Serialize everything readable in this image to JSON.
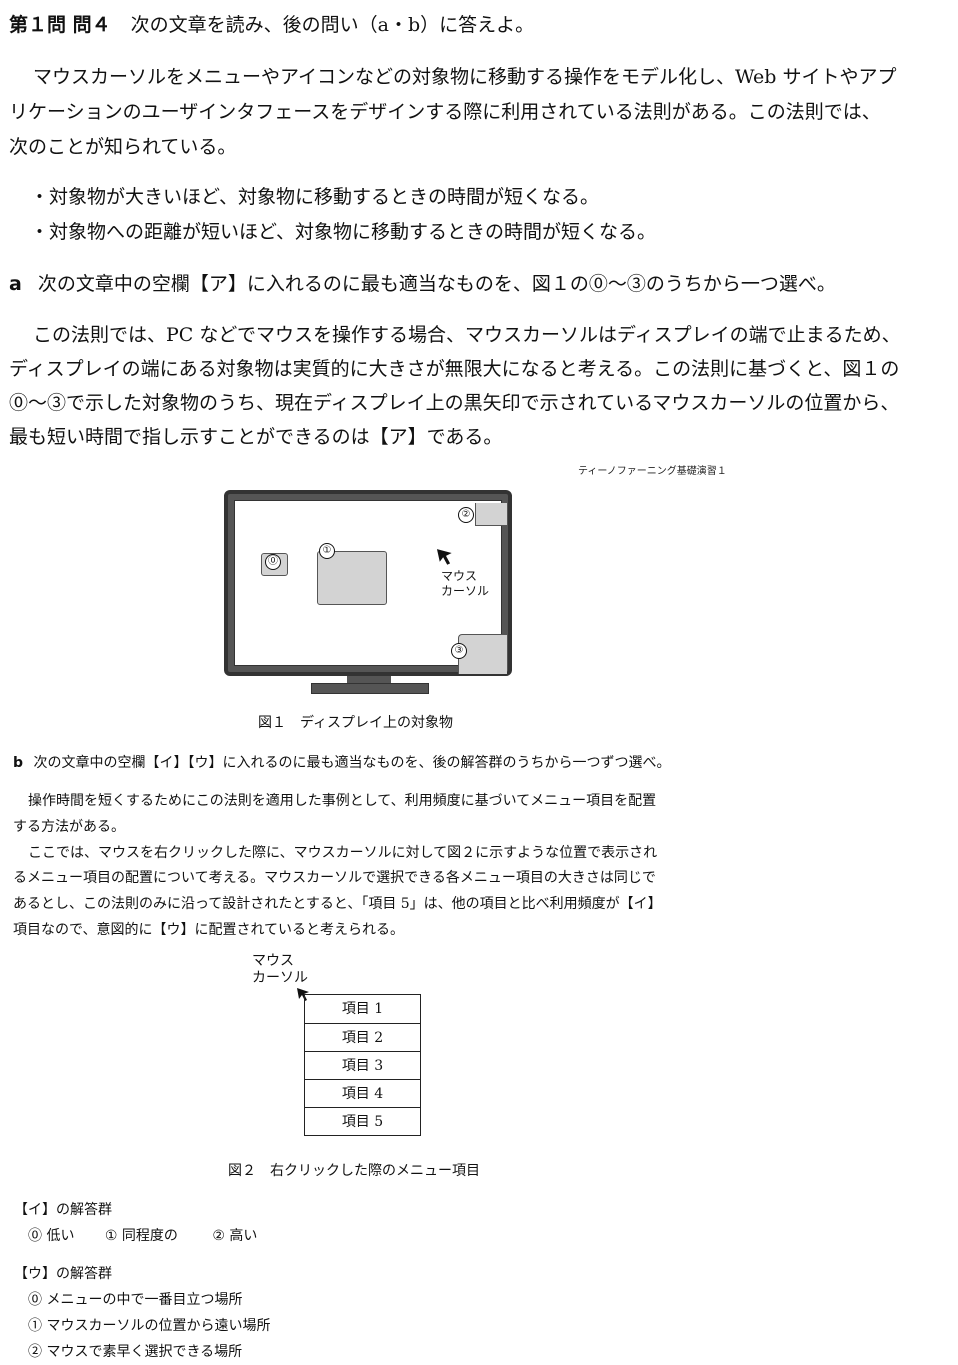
{
  "heading": {
    "num": "第１問 問４",
    "text": "次の文章を読み、後の問い（a・b）に答えよ。"
  },
  "intro": [
    "マウスカーソルをメニューやアイコンなどの対象物に移動する操作をモデル化し、Web サイトやアプ",
    "リケーションのユーザインタフェースをデザインする際に利用されている法則がある。この法則では、",
    "次のことが知られている。"
  ],
  "bullets": [
    "・対象物が大きいほど、対象物に移動するときの時間が短くなる。",
    "・対象物への距離が短いほど、対象物に移動するときの時間が短くなる。"
  ],
  "part_a": {
    "label": "a",
    "question": "次の文章中の空欄【ア】に入れるのに最も適当なものを、図１の⓪～③のうちから一つ選べ。",
    "body": [
      "この法則では、PC などでマウスを操作する場合、マウスカーソルはディスプレイの端で止まるため、",
      "ディスプレイの端にある対象物は実質的に大きさが無限大になると考える。この法則に基づくと、図１の",
      "⓪～③で示した対象物のうち、現在ディスプレイ上の黒矢印で示されているマウスカーソルの位置から、",
      "最も短い時間で指し示すことができるのは【ア】である。"
    ]
  },
  "watermark": "ティーノファーニング基礎演習１",
  "figure1": {
    "markers": [
      "⓪",
      "①",
      "②",
      "③"
    ],
    "cursor_label": [
      "マウス",
      "カーソル"
    ],
    "caption": "図１　ディスプレイ上の対象物"
  },
  "part_b": {
    "label": "b",
    "question": "次の文章中の空欄【イ】【ウ】に入れるのに最も適当なものを、後の解答群のうちから一つずつ選べ。",
    "body": [
      "操作時間を短くするためにこの法則を適用した事例として、利用頻度に基づいてメニュー項目を配置",
      "する方法がある。",
      "ここでは、マウスを右クリックした際に、マウスカーソルに対して図２に示すような位置で表示され",
      "るメニュー項目の配置について考える。マウスカーソルで選択できる各メニュー項目の大きさは同じで",
      "あるとし、この法則のみに沿って設計されたとすると、「項目 5」は、他の項目と比べ利用頻度が【イ】",
      "項目なので、意図的に【ウ】に配置されていると考えられる。"
    ]
  },
  "figure2": {
    "cursor_label": [
      "マウス",
      "カーソル"
    ],
    "items": [
      "項目 1",
      "項目 2",
      "項目 3",
      "項目 4",
      "項目 5"
    ],
    "caption": "図２　右クリックした際のメニュー項目"
  },
  "answers_i": {
    "title": "【イ】の解答群",
    "options": [
      "⓪ 低い",
      "① 同程度の",
      "② 高い"
    ]
  },
  "answers_u": {
    "title": "【ウ】の解答群",
    "options": [
      "⓪ メニューの中で一番目立つ場所",
      "① マウスカーソルの位置から遠い場所",
      "② マウスで素早く選択できる場所"
    ]
  }
}
